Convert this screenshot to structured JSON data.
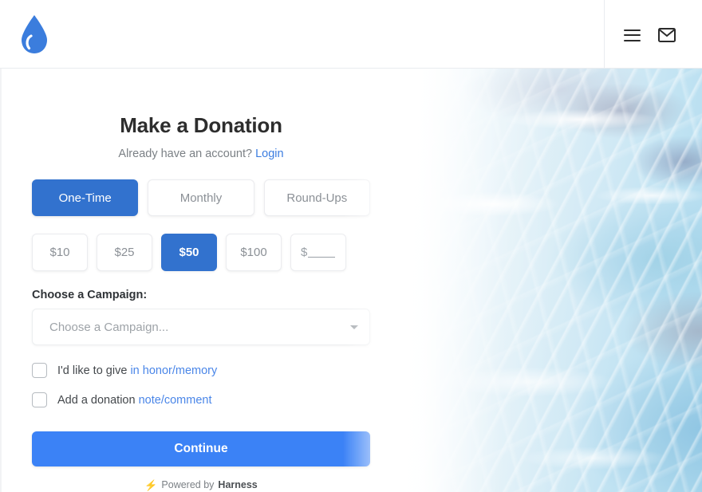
{
  "header": {
    "logo_icon": "water-drop-logo",
    "menu_icon": "hamburger-menu-icon",
    "mail_icon": "envelope-icon"
  },
  "main": {
    "title": "Make a Donation",
    "account_prompt": "Already have an account?",
    "login_label": "Login",
    "frequency_options": [
      {
        "label": "One-Time",
        "selected": true
      },
      {
        "label": "Monthly",
        "selected": false
      },
      {
        "label": "Round-Ups",
        "selected": false
      }
    ],
    "amount_options": [
      {
        "label": "$10",
        "selected": false
      },
      {
        "label": "$25",
        "selected": false
      },
      {
        "label": "$50",
        "selected": true
      },
      {
        "label": "$100",
        "selected": false
      }
    ],
    "custom_amount": {
      "currency_symbol": "$",
      "value": ""
    },
    "campaign": {
      "label": "Choose a Campaign:",
      "placeholder": "Choose a Campaign...",
      "value": "",
      "caret_icon": "chevron-down-icon"
    },
    "checkboxes": [
      {
        "checked": false,
        "text": "I'd like to give ",
        "link_text": "in honor/memory"
      },
      {
        "checked": false,
        "text": "Add a donation ",
        "link_text": "note/comment"
      }
    ],
    "submit_label": "Continue",
    "footer": {
      "bolt_icon": "⚡",
      "powered_text": "Powered by",
      "brand": "Harness"
    }
  },
  "colors": {
    "primary_blue": "#3272ce",
    "cta_blue": "#3b82f6",
    "link_blue": "#4a86e8",
    "logo_blue": "#3b7ddd",
    "muted_text": "#8b9096"
  }
}
